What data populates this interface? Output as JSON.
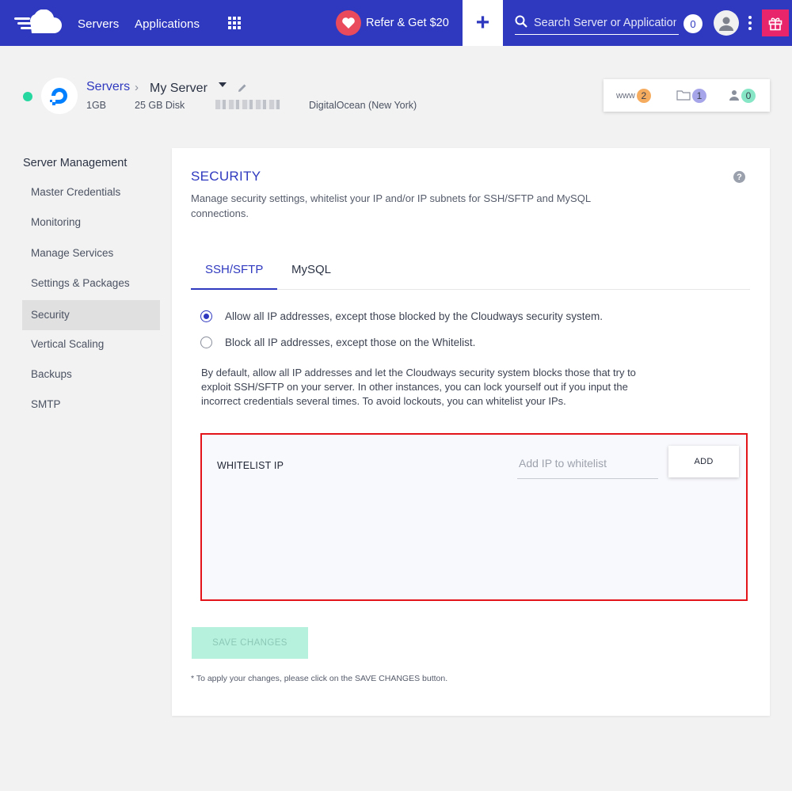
{
  "colors": {
    "brand": "#2f39bf",
    "accent_pink": "#e8246a",
    "refer_heart": "#e94b5d",
    "status_online": "#27d7a0",
    "highlight_red": "#e3151a",
    "save_disabled": "#b6f1de"
  },
  "topbar": {
    "nav": {
      "servers": "Servers",
      "applications": "Applications"
    },
    "refer_label": "Refer & Get $20",
    "plus_label": "+",
    "search_placeholder": "Search Server or Application",
    "notification_count": "0"
  },
  "server": {
    "breadcrumb_root": "Servers",
    "breadcrumb_sep": "›",
    "name": "My Server",
    "ram": "1GB",
    "disk": "25 GB Disk",
    "provider": "DigitalOcean (New York)"
  },
  "counts": {
    "www_label": "www",
    "www_count": "2",
    "files_count": "1",
    "users_count": "0"
  },
  "sidebar": {
    "title": "Server Management",
    "items": [
      {
        "label": "Master Credentials"
      },
      {
        "label": "Monitoring"
      },
      {
        "label": "Manage Services"
      },
      {
        "label": "Settings & Packages"
      },
      {
        "label": "Security"
      },
      {
        "label": "Vertical Scaling"
      },
      {
        "label": "Backups"
      },
      {
        "label": "SMTP"
      }
    ],
    "active_item": "Security"
  },
  "security": {
    "title": "SECURITY",
    "help_label": "?",
    "description": "Manage security settings, whitelist your IP and/or IP subnets for SSH/SFTP and MySQL connections.",
    "tabs": [
      {
        "label": "SSH/SFTP"
      },
      {
        "label": "MySQL"
      }
    ],
    "active_tab": "SSH/SFTP",
    "options": [
      {
        "label": "Allow all IP addresses, except those blocked by the Cloudways security system.",
        "selected": true
      },
      {
        "label": "Block all IP addresses, except those on the Whitelist.",
        "selected": false
      }
    ],
    "info": "By default, allow all IP addresses and let the Cloudways security system blocks those that try to exploit SSH/SFTP on your server. In other instances, you can lock yourself out if you input the incorrect credentials several times. To avoid lockouts, you can whitelist your IPs.",
    "whitelist": {
      "label": "WHITELIST IP",
      "input_placeholder": "Add IP to whitelist",
      "input_value": "",
      "add_label": "ADD"
    },
    "save_label": "SAVE CHANGES",
    "footnote": "* To apply your changes, please click on the SAVE CHANGES button."
  }
}
